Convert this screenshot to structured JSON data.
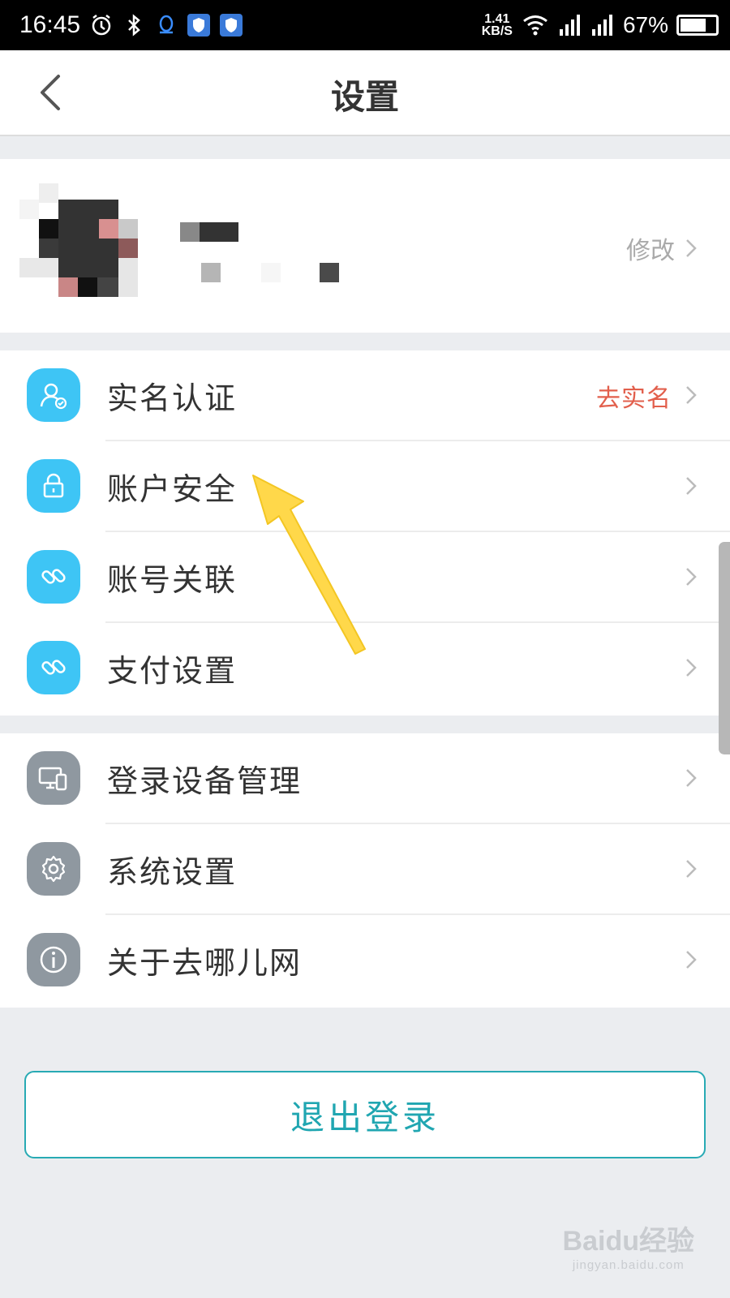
{
  "status_bar": {
    "time": "16:45",
    "network_speed_value": "1.41",
    "network_speed_unit": "KB/S",
    "battery": "67%",
    "battery_level": 0.67
  },
  "header": {
    "title": "设置",
    "back_icon": "chevron-left-icon"
  },
  "profile": {
    "edit_label": "修改"
  },
  "group1": [
    {
      "label": "实名认证",
      "icon": "user-verified-icon",
      "extra": "去实名",
      "color": "#3ec5f5"
    },
    {
      "label": "账户安全",
      "icon": "lock-icon",
      "extra": "",
      "color": "#3ec5f5"
    },
    {
      "label": "账号关联",
      "icon": "link-icon",
      "extra": "",
      "color": "#3ec5f5"
    },
    {
      "label": "支付设置",
      "icon": "link-icon",
      "extra": "",
      "color": "#3ec5f5"
    }
  ],
  "group2": [
    {
      "label": "登录设备管理",
      "icon": "devices-icon",
      "color": "#8f98a0"
    },
    {
      "label": "系统设置",
      "icon": "gear-icon",
      "color": "#8f98a0"
    },
    {
      "label": "关于去哪儿网",
      "icon": "info-icon",
      "color": "#8f98a0"
    }
  ],
  "logout_label": "退出登录",
  "watermark": {
    "logo": "Baidu经验",
    "url": "jingyan.baidu.com"
  },
  "colors": {
    "accent_teal": "#20a6b1",
    "extra_red": "#e25f4c",
    "annotation_arrow": "#ffd84a"
  }
}
